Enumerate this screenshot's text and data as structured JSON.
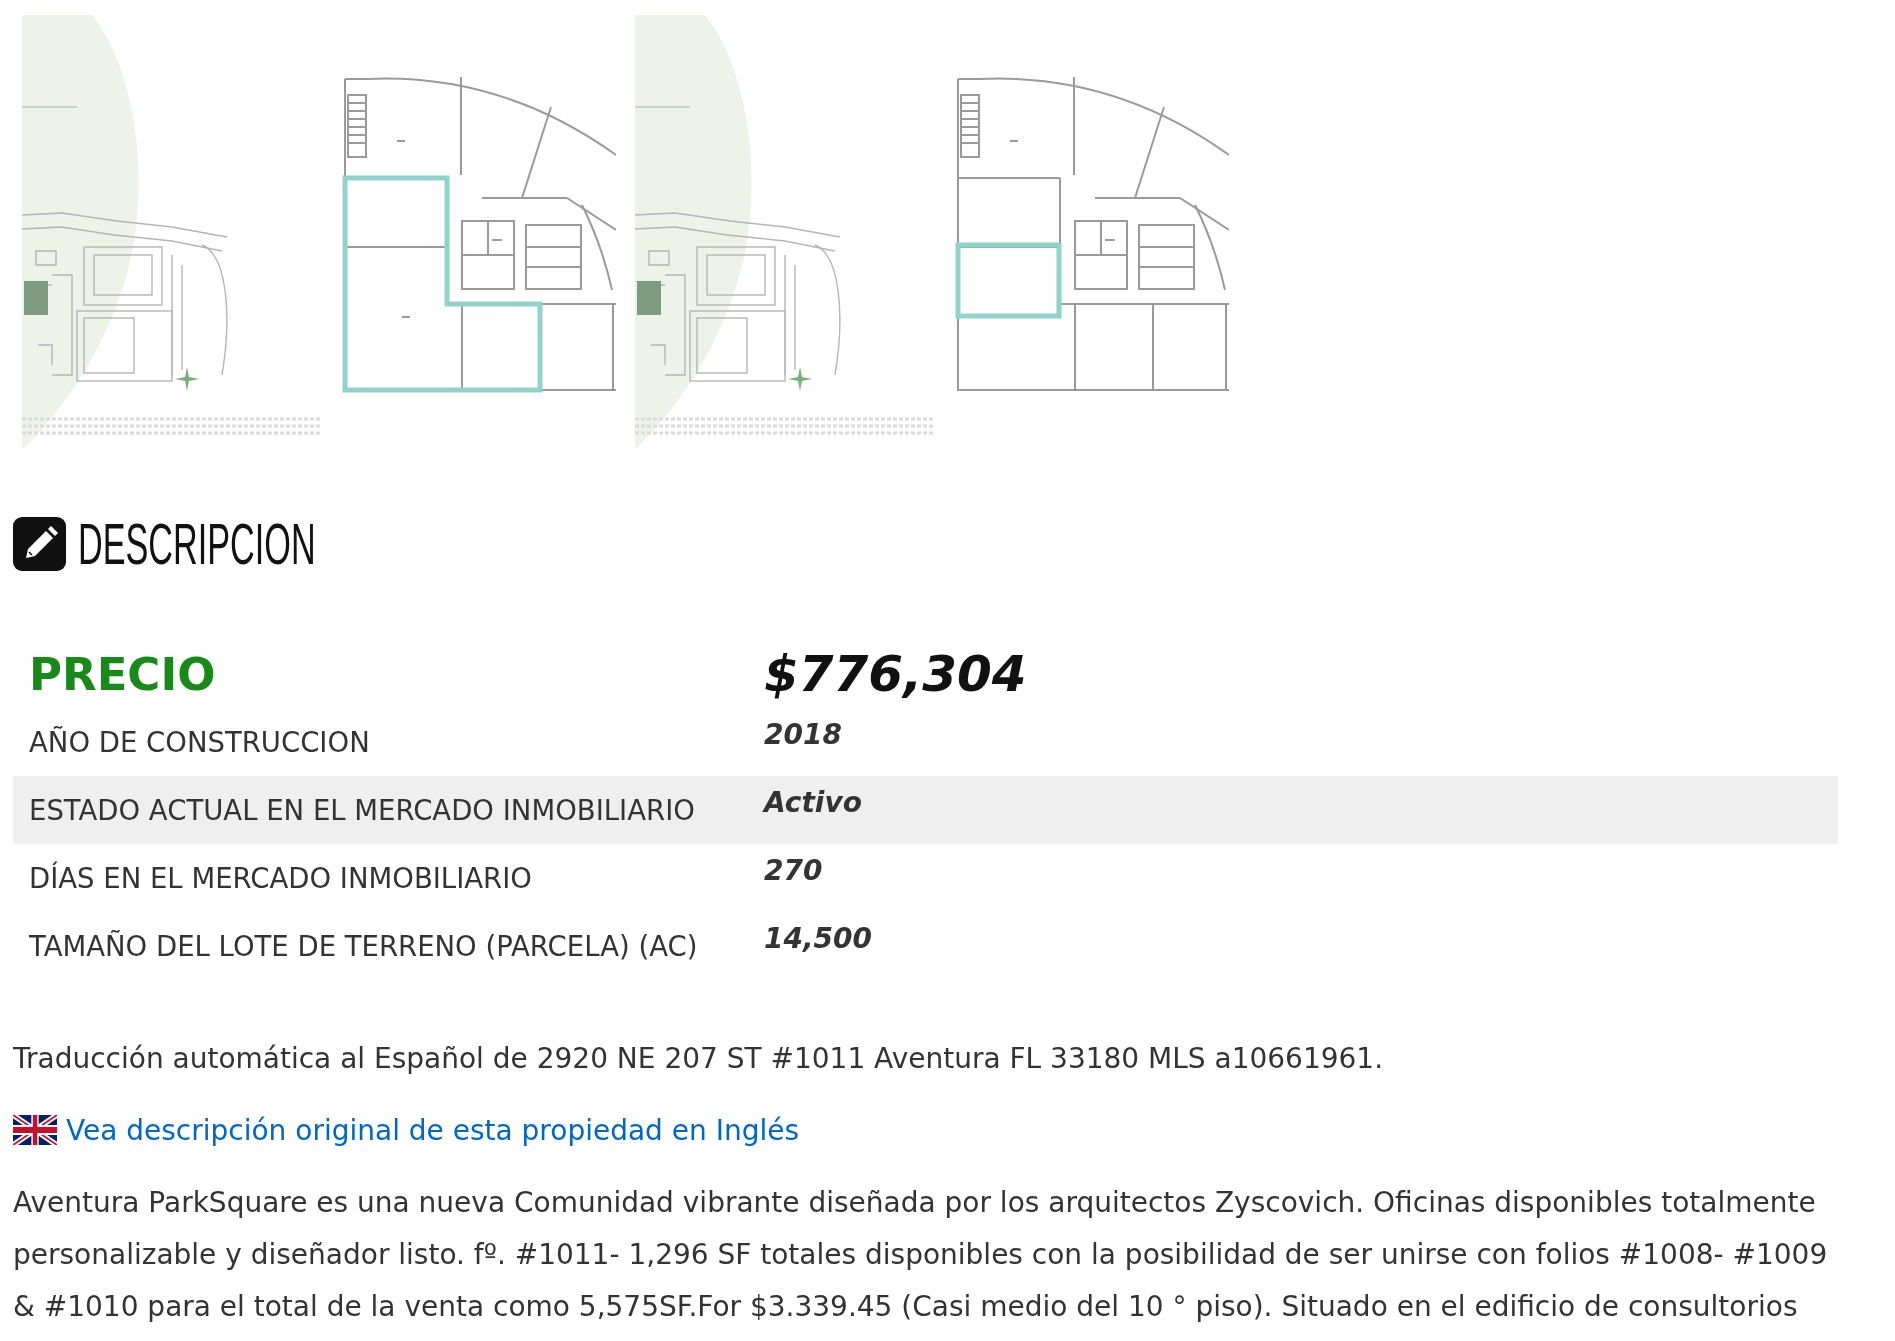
{
  "gallery": {
    "images": [
      {
        "kind": "combined"
      },
      {
        "kind": "single"
      }
    ]
  },
  "section": {
    "title": "DESCRIPCION"
  },
  "property_table": {
    "rows": [
      {
        "kind": "price",
        "label": "PRECIO",
        "value": "$776,304",
        "highlighted": false
      },
      {
        "kind": "detail",
        "label": "AÑO DE CONSTRUCCION",
        "value": "2018",
        "highlighted": false
      },
      {
        "kind": "detail",
        "label": "ESTADO ACTUAL EN EL MERCADO INMOBILIARIO",
        "value": "Activo",
        "highlighted": true
      },
      {
        "kind": "detail",
        "label": "DÍAS EN EL MERCADO INMOBILIARIO",
        "value": "270",
        "highlighted": false
      },
      {
        "kind": "detail",
        "label": "TAMAÑO DEL LOTE DE TERRENO (PARCELA) (AC)",
        "value": "14,500",
        "highlighted": false
      }
    ]
  },
  "translation_note": "Traducción automática al Español de 2920 NE 207 ST #1011 Aventura FL 33180 MLS a10661961.",
  "original_link": {
    "text": "Vea descripción original de esta propiedad en Inglés"
  },
  "description": "Aventura ParkSquare es una nueva Comunidad vibrante diseñada por los arquitectos Zyscovich. Oficinas disponibles totalmente personalizable y diseñador listo. fº. #1011- 1,296 SF totales disponibles con la posibilidad de ser unirse con folios #1008- #1009 & #1010 para el total de la venta como 5,575SF.For $3.339.45 (Casi medio del 10 ° piso). Situado en el edificio de consultorios"
}
